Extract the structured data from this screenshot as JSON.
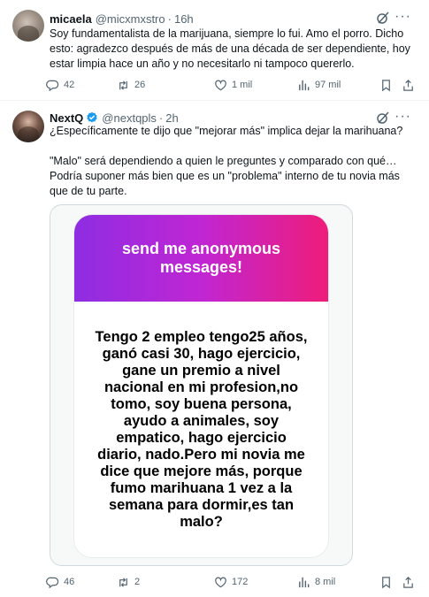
{
  "tweets": [
    {
      "name": "micaela",
      "handle": "@micxmxstro",
      "time": "16h",
      "text": "Soy fundamentalista de la marijuana, siempre lo fui. Amo el porro. Dicho esto: agradezco después de más de una década de ser dependiente, hoy estar limpia hace un año y no necesitarlo ni tampoco quererlo.",
      "stats": {
        "replies": "42",
        "reposts": "26",
        "likes": "1 mil",
        "views": "97 mil"
      }
    },
    {
      "name": "NextQ",
      "handle": "@nextqpls",
      "time": "2h",
      "text": "¿Específicamente te dijo que \"mejorar más\" implica dejar la marihuana?\n\n\"Malo\" será dependiendo a quien le preguntes y comparado con qué…\nPodría suponer más bien que es un \"problema\" interno de tu novia más que de tu parte.",
      "media": {
        "card_title": "send me anonymous messages!",
        "card_message": "Tengo 2 empleo tengo25 años, ganó casi 30, hago ejercicio, gane un premio a nivel nacional en mi profesion,no tomo, soy buena persona, ayudo a animales, soy empatico, hago ejercicio diario, nado.Pero mi novia me dice que mejore más, porque fumo marihuana 1 vez a la semana para dormir,es tan malo?"
      },
      "stats": {
        "replies": "46",
        "reposts": "2",
        "likes": "172",
        "views": "8 mil"
      }
    }
  ],
  "colors": {
    "text": "#0f1419",
    "secondary": "#536471",
    "verified": "#1d9bf0",
    "card_gradient_start": "#8e2de2",
    "card_gradient_end": "#ee1d7a"
  },
  "icons": [
    "grok-icon",
    "more-icon",
    "reply-icon",
    "repost-icon",
    "like-icon",
    "views-icon",
    "bookmark-icon",
    "share-icon",
    "verified-badge-icon"
  ]
}
